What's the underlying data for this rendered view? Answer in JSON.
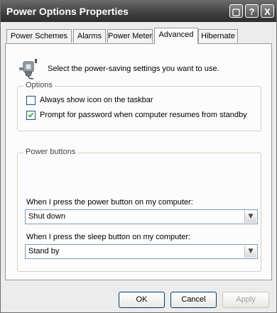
{
  "window": {
    "title": "Power Options Properties"
  },
  "titlebar_buttons": [
    {
      "name": "minimize",
      "glyph": "▢"
    },
    {
      "name": "help",
      "glyph": "?"
    },
    {
      "name": "close",
      "glyph": "X"
    }
  ],
  "tabs": [
    {
      "label": "Power Schemes",
      "active": false
    },
    {
      "label": "Alarms",
      "active": false
    },
    {
      "label": "Power Meter",
      "active": false
    },
    {
      "label": "Advanced",
      "active": true
    },
    {
      "label": "Hibernate",
      "active": false
    }
  ],
  "intro_text": "Select the power-saving settings you want to use.",
  "options": {
    "legend": "Options",
    "always_show_icon": {
      "label": "Always show icon on the taskbar",
      "checked": false
    },
    "prompt_password": {
      "label": "Prompt for password when computer resumes from standby",
      "checked": true
    }
  },
  "power_buttons": {
    "legend": "Power buttons",
    "power_label": "When I press the power button on my computer:",
    "power_value": "Shut down",
    "sleep_label": "When I press the sleep button on my computer:",
    "sleep_value": "Stand by"
  },
  "buttons": {
    "ok": "OK",
    "cancel": "Cancel",
    "apply": "Apply"
  }
}
